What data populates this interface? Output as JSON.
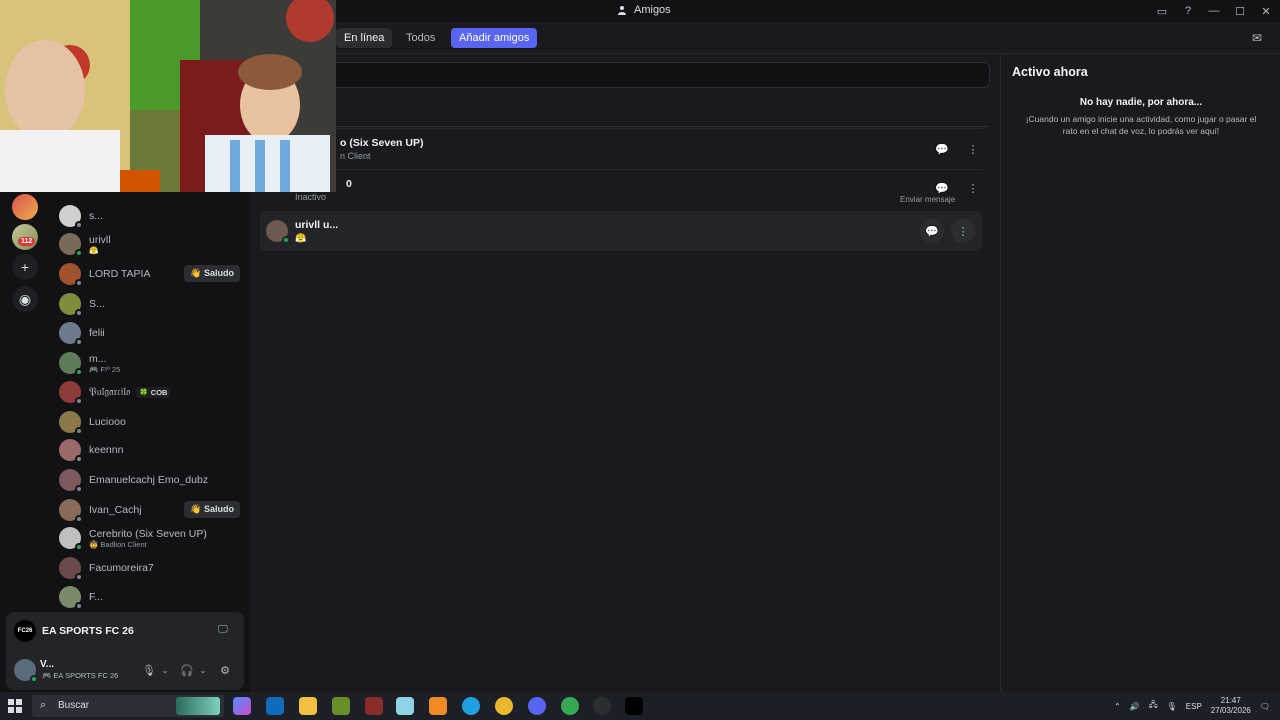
{
  "window": {
    "title": "Amigos"
  },
  "header": {
    "tabs": [
      {
        "label": "En línea"
      },
      {
        "label": "Todos"
      },
      {
        "label": "Añadir amigos"
      }
    ]
  },
  "friends": [
    {
      "name": "o (Six Seven UP)",
      "sub": "n Client"
    },
    {
      "name": "0",
      "sub": "Inactivo"
    },
    {
      "name": "urivll u...",
      "sub": "😤"
    }
  ],
  "tooltip": "Enviar mensaje",
  "rail": {
    "badge": "112"
  },
  "dms": [
    {
      "name": "s...",
      "sub": "",
      "status": "offline"
    },
    {
      "name": "urivll",
      "sub": "😤",
      "status": "online"
    },
    {
      "name": "LORD TAPIA",
      "sub": "",
      "status": "offline",
      "pill": "👋 Saludo"
    },
    {
      "name": "S...",
      "sub": "",
      "status": "offline"
    },
    {
      "name": "felii",
      "sub": "",
      "status": "offline"
    },
    {
      "name": "m...",
      "sub": "🎮 F!º 25",
      "status": "online"
    },
    {
      "name": "𝔓𝔲𝔩𝔤𝔞𝔯𝔠𝔦𝔩𝔬",
      "sub": "",
      "status": "offline",
      "tag": "🍀 COB"
    },
    {
      "name": "Luciooo",
      "sub": "",
      "status": "offline"
    },
    {
      "name": "keennn",
      "sub": "",
      "status": "offline"
    },
    {
      "name": "Emanuelcachj Emo_dubz",
      "sub": "",
      "status": "offline"
    },
    {
      "name": "Ivan_Cachj",
      "sub": "",
      "status": "offline",
      "pill": "👋 Saludo"
    },
    {
      "name": "Cerebrito (Six Seven UP)",
      "sub": "🤠 Badlion Client",
      "status": "online"
    },
    {
      "name": "Facumoreira7",
      "sub": "",
      "status": "offline"
    },
    {
      "name": "F...",
      "sub": "",
      "status": "offline"
    }
  ],
  "game_card": {
    "name": "EA SPORTS FC 26",
    "logo": "FC26"
  },
  "user": {
    "name": "V...",
    "game": "🎮 EA SPORTS FC 26"
  },
  "active_now": {
    "title": "Activo ahora",
    "empty_title": "No hay nadie, por ahora...",
    "empty_text": "¡Cuando un amigo inicie una actividad, como jugar o pasar el rato en el chat de voz, lo podrás ver aquí!"
  },
  "taskbar": {
    "search": "Buscar",
    "lang": "ESP",
    "time": "21:47",
    "date": "27/03/2026"
  },
  "colors": {
    "accent": "#5865f2",
    "online": "#23a55a",
    "badge": "#da373c"
  }
}
